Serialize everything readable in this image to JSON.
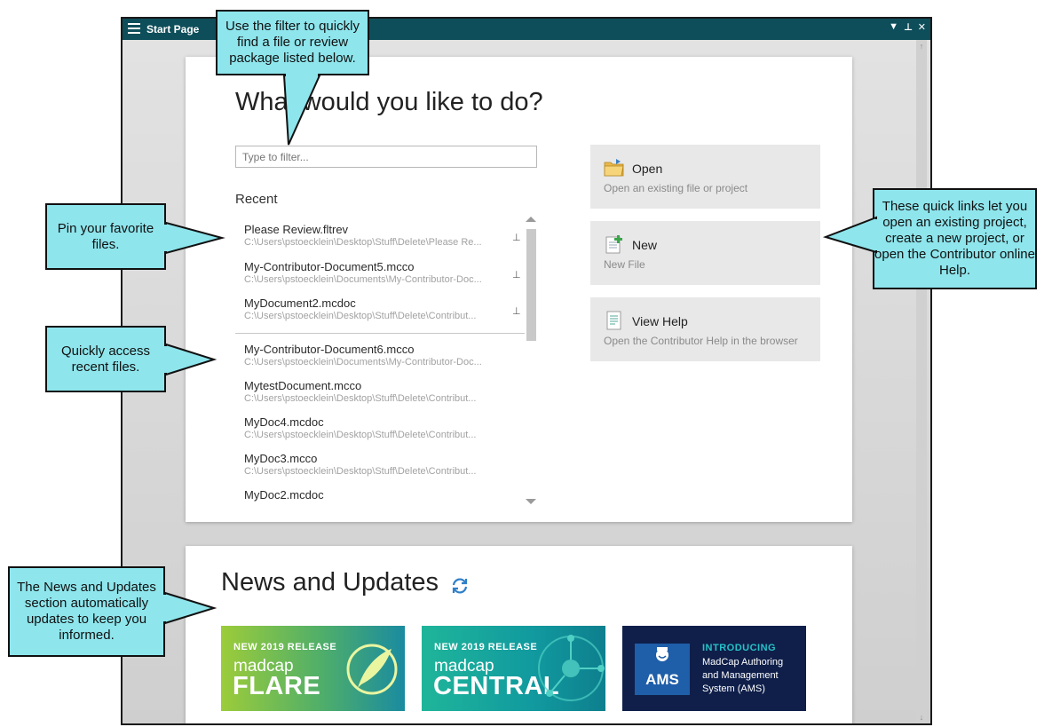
{
  "window": {
    "title": "Start Page"
  },
  "start": {
    "heading": "What would you like to do?",
    "filter_placeholder": "Type to filter...",
    "recent_label": "Recent",
    "pinned": [
      {
        "name": "Please Review.fltrev",
        "path": "C:\\Users\\pstoecklein\\Desktop\\Stuff\\Delete\\Please Re..."
      },
      {
        "name": "My-Contributor-Document5.mcco",
        "path": "C:\\Users\\pstoecklein\\Documents\\My-Contributor-Doc..."
      },
      {
        "name": "MyDocument2.mcdoc",
        "path": "C:\\Users\\pstoecklein\\Desktop\\Stuff\\Delete\\Contribut..."
      }
    ],
    "recent": [
      {
        "name": "My-Contributor-Document6.mcco",
        "path": "C:\\Users\\pstoecklein\\Documents\\My-Contributor-Doc..."
      },
      {
        "name": "MytestDocument.mcco",
        "path": "C:\\Users\\pstoecklein\\Desktop\\Stuff\\Delete\\Contribut..."
      },
      {
        "name": "MyDoc4.mcdoc",
        "path": "C:\\Users\\pstoecklein\\Desktop\\Stuff\\Delete\\Contribut..."
      },
      {
        "name": "MyDoc3.mcco",
        "path": "C:\\Users\\pstoecklein\\Desktop\\Stuff\\Delete\\Contribut..."
      },
      {
        "name": "MyDoc2.mcdoc",
        "path": ""
      }
    ],
    "quick_links": [
      {
        "title": "Open",
        "desc": "Open an existing file or project",
        "icon": "folder-icon"
      },
      {
        "title": "New",
        "desc": "New File",
        "icon": "new-file-icon"
      },
      {
        "title": "View Help",
        "desc": "Open the Contributor Help in the browser",
        "icon": "help-document-icon"
      }
    ]
  },
  "news": {
    "title": "News and Updates",
    "banners": [
      {
        "kicker": "NEW 2019 RELEASE",
        "brand": "madcap",
        "product": "FLARE"
      },
      {
        "kicker": "NEW 2019 RELEASE",
        "brand": "madcap",
        "product": "CENTRAL"
      },
      {
        "kicker": "INTRODUCING",
        "line1": "MadCap Authoring",
        "line2": "and Management",
        "line3": "System (AMS)",
        "logo": "AMS"
      }
    ]
  },
  "callouts": {
    "filter": "Use the filter to quickly find a file or review package listed below.",
    "pin": "Pin your favorite files.",
    "recent": "Quickly access recent files.",
    "news": "The News and Updates section automatically updates to keep you informed.",
    "quick": "These quick links let you open an existing project, create a new project, or open the Contributor online Help."
  },
  "colors": {
    "titlebar": "#0e4e5a",
    "callout": "#8ee5ec",
    "flare": "#7cc242",
    "central": "#16a3a0",
    "ams": "#0f1f4a"
  }
}
